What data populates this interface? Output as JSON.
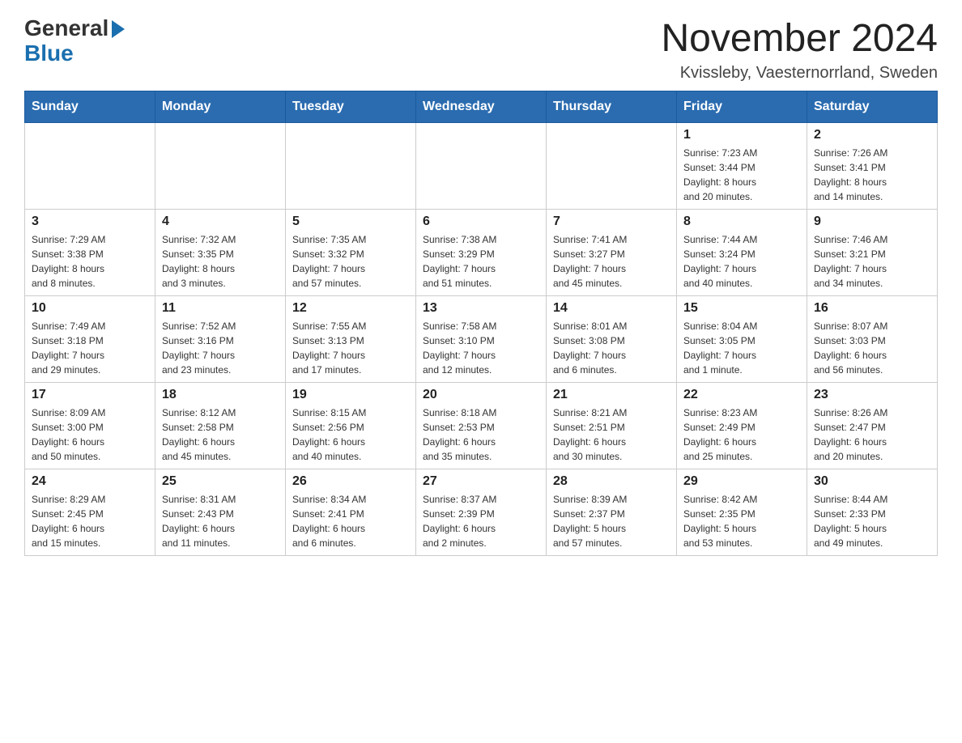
{
  "logo": {
    "general": "General",
    "blue": "Blue"
  },
  "title": {
    "month_year": "November 2024",
    "location": "Kvissleby, Vaesternorrland, Sweden"
  },
  "days_of_week": [
    "Sunday",
    "Monday",
    "Tuesday",
    "Wednesday",
    "Thursday",
    "Friday",
    "Saturday"
  ],
  "weeks": [
    [
      {
        "day": "",
        "info": ""
      },
      {
        "day": "",
        "info": ""
      },
      {
        "day": "",
        "info": ""
      },
      {
        "day": "",
        "info": ""
      },
      {
        "day": "",
        "info": ""
      },
      {
        "day": "1",
        "info": "Sunrise: 7:23 AM\nSunset: 3:44 PM\nDaylight: 8 hours\nand 20 minutes."
      },
      {
        "day": "2",
        "info": "Sunrise: 7:26 AM\nSunset: 3:41 PM\nDaylight: 8 hours\nand 14 minutes."
      }
    ],
    [
      {
        "day": "3",
        "info": "Sunrise: 7:29 AM\nSunset: 3:38 PM\nDaylight: 8 hours\nand 8 minutes."
      },
      {
        "day": "4",
        "info": "Sunrise: 7:32 AM\nSunset: 3:35 PM\nDaylight: 8 hours\nand 3 minutes."
      },
      {
        "day": "5",
        "info": "Sunrise: 7:35 AM\nSunset: 3:32 PM\nDaylight: 7 hours\nand 57 minutes."
      },
      {
        "day": "6",
        "info": "Sunrise: 7:38 AM\nSunset: 3:29 PM\nDaylight: 7 hours\nand 51 minutes."
      },
      {
        "day": "7",
        "info": "Sunrise: 7:41 AM\nSunset: 3:27 PM\nDaylight: 7 hours\nand 45 minutes."
      },
      {
        "day": "8",
        "info": "Sunrise: 7:44 AM\nSunset: 3:24 PM\nDaylight: 7 hours\nand 40 minutes."
      },
      {
        "day": "9",
        "info": "Sunrise: 7:46 AM\nSunset: 3:21 PM\nDaylight: 7 hours\nand 34 minutes."
      }
    ],
    [
      {
        "day": "10",
        "info": "Sunrise: 7:49 AM\nSunset: 3:18 PM\nDaylight: 7 hours\nand 29 minutes."
      },
      {
        "day": "11",
        "info": "Sunrise: 7:52 AM\nSunset: 3:16 PM\nDaylight: 7 hours\nand 23 minutes."
      },
      {
        "day": "12",
        "info": "Sunrise: 7:55 AM\nSunset: 3:13 PM\nDaylight: 7 hours\nand 17 minutes."
      },
      {
        "day": "13",
        "info": "Sunrise: 7:58 AM\nSunset: 3:10 PM\nDaylight: 7 hours\nand 12 minutes."
      },
      {
        "day": "14",
        "info": "Sunrise: 8:01 AM\nSunset: 3:08 PM\nDaylight: 7 hours\nand 6 minutes."
      },
      {
        "day": "15",
        "info": "Sunrise: 8:04 AM\nSunset: 3:05 PM\nDaylight: 7 hours\nand 1 minute."
      },
      {
        "day": "16",
        "info": "Sunrise: 8:07 AM\nSunset: 3:03 PM\nDaylight: 6 hours\nand 56 minutes."
      }
    ],
    [
      {
        "day": "17",
        "info": "Sunrise: 8:09 AM\nSunset: 3:00 PM\nDaylight: 6 hours\nand 50 minutes."
      },
      {
        "day": "18",
        "info": "Sunrise: 8:12 AM\nSunset: 2:58 PM\nDaylight: 6 hours\nand 45 minutes."
      },
      {
        "day": "19",
        "info": "Sunrise: 8:15 AM\nSunset: 2:56 PM\nDaylight: 6 hours\nand 40 minutes."
      },
      {
        "day": "20",
        "info": "Sunrise: 8:18 AM\nSunset: 2:53 PM\nDaylight: 6 hours\nand 35 minutes."
      },
      {
        "day": "21",
        "info": "Sunrise: 8:21 AM\nSunset: 2:51 PM\nDaylight: 6 hours\nand 30 minutes."
      },
      {
        "day": "22",
        "info": "Sunrise: 8:23 AM\nSunset: 2:49 PM\nDaylight: 6 hours\nand 25 minutes."
      },
      {
        "day": "23",
        "info": "Sunrise: 8:26 AM\nSunset: 2:47 PM\nDaylight: 6 hours\nand 20 minutes."
      }
    ],
    [
      {
        "day": "24",
        "info": "Sunrise: 8:29 AM\nSunset: 2:45 PM\nDaylight: 6 hours\nand 15 minutes."
      },
      {
        "day": "25",
        "info": "Sunrise: 8:31 AM\nSunset: 2:43 PM\nDaylight: 6 hours\nand 11 minutes."
      },
      {
        "day": "26",
        "info": "Sunrise: 8:34 AM\nSunset: 2:41 PM\nDaylight: 6 hours\nand 6 minutes."
      },
      {
        "day": "27",
        "info": "Sunrise: 8:37 AM\nSunset: 2:39 PM\nDaylight: 6 hours\nand 2 minutes."
      },
      {
        "day": "28",
        "info": "Sunrise: 8:39 AM\nSunset: 2:37 PM\nDaylight: 5 hours\nand 57 minutes."
      },
      {
        "day": "29",
        "info": "Sunrise: 8:42 AM\nSunset: 2:35 PM\nDaylight: 5 hours\nand 53 minutes."
      },
      {
        "day": "30",
        "info": "Sunrise: 8:44 AM\nSunset: 2:33 PM\nDaylight: 5 hours\nand 49 minutes."
      }
    ]
  ]
}
